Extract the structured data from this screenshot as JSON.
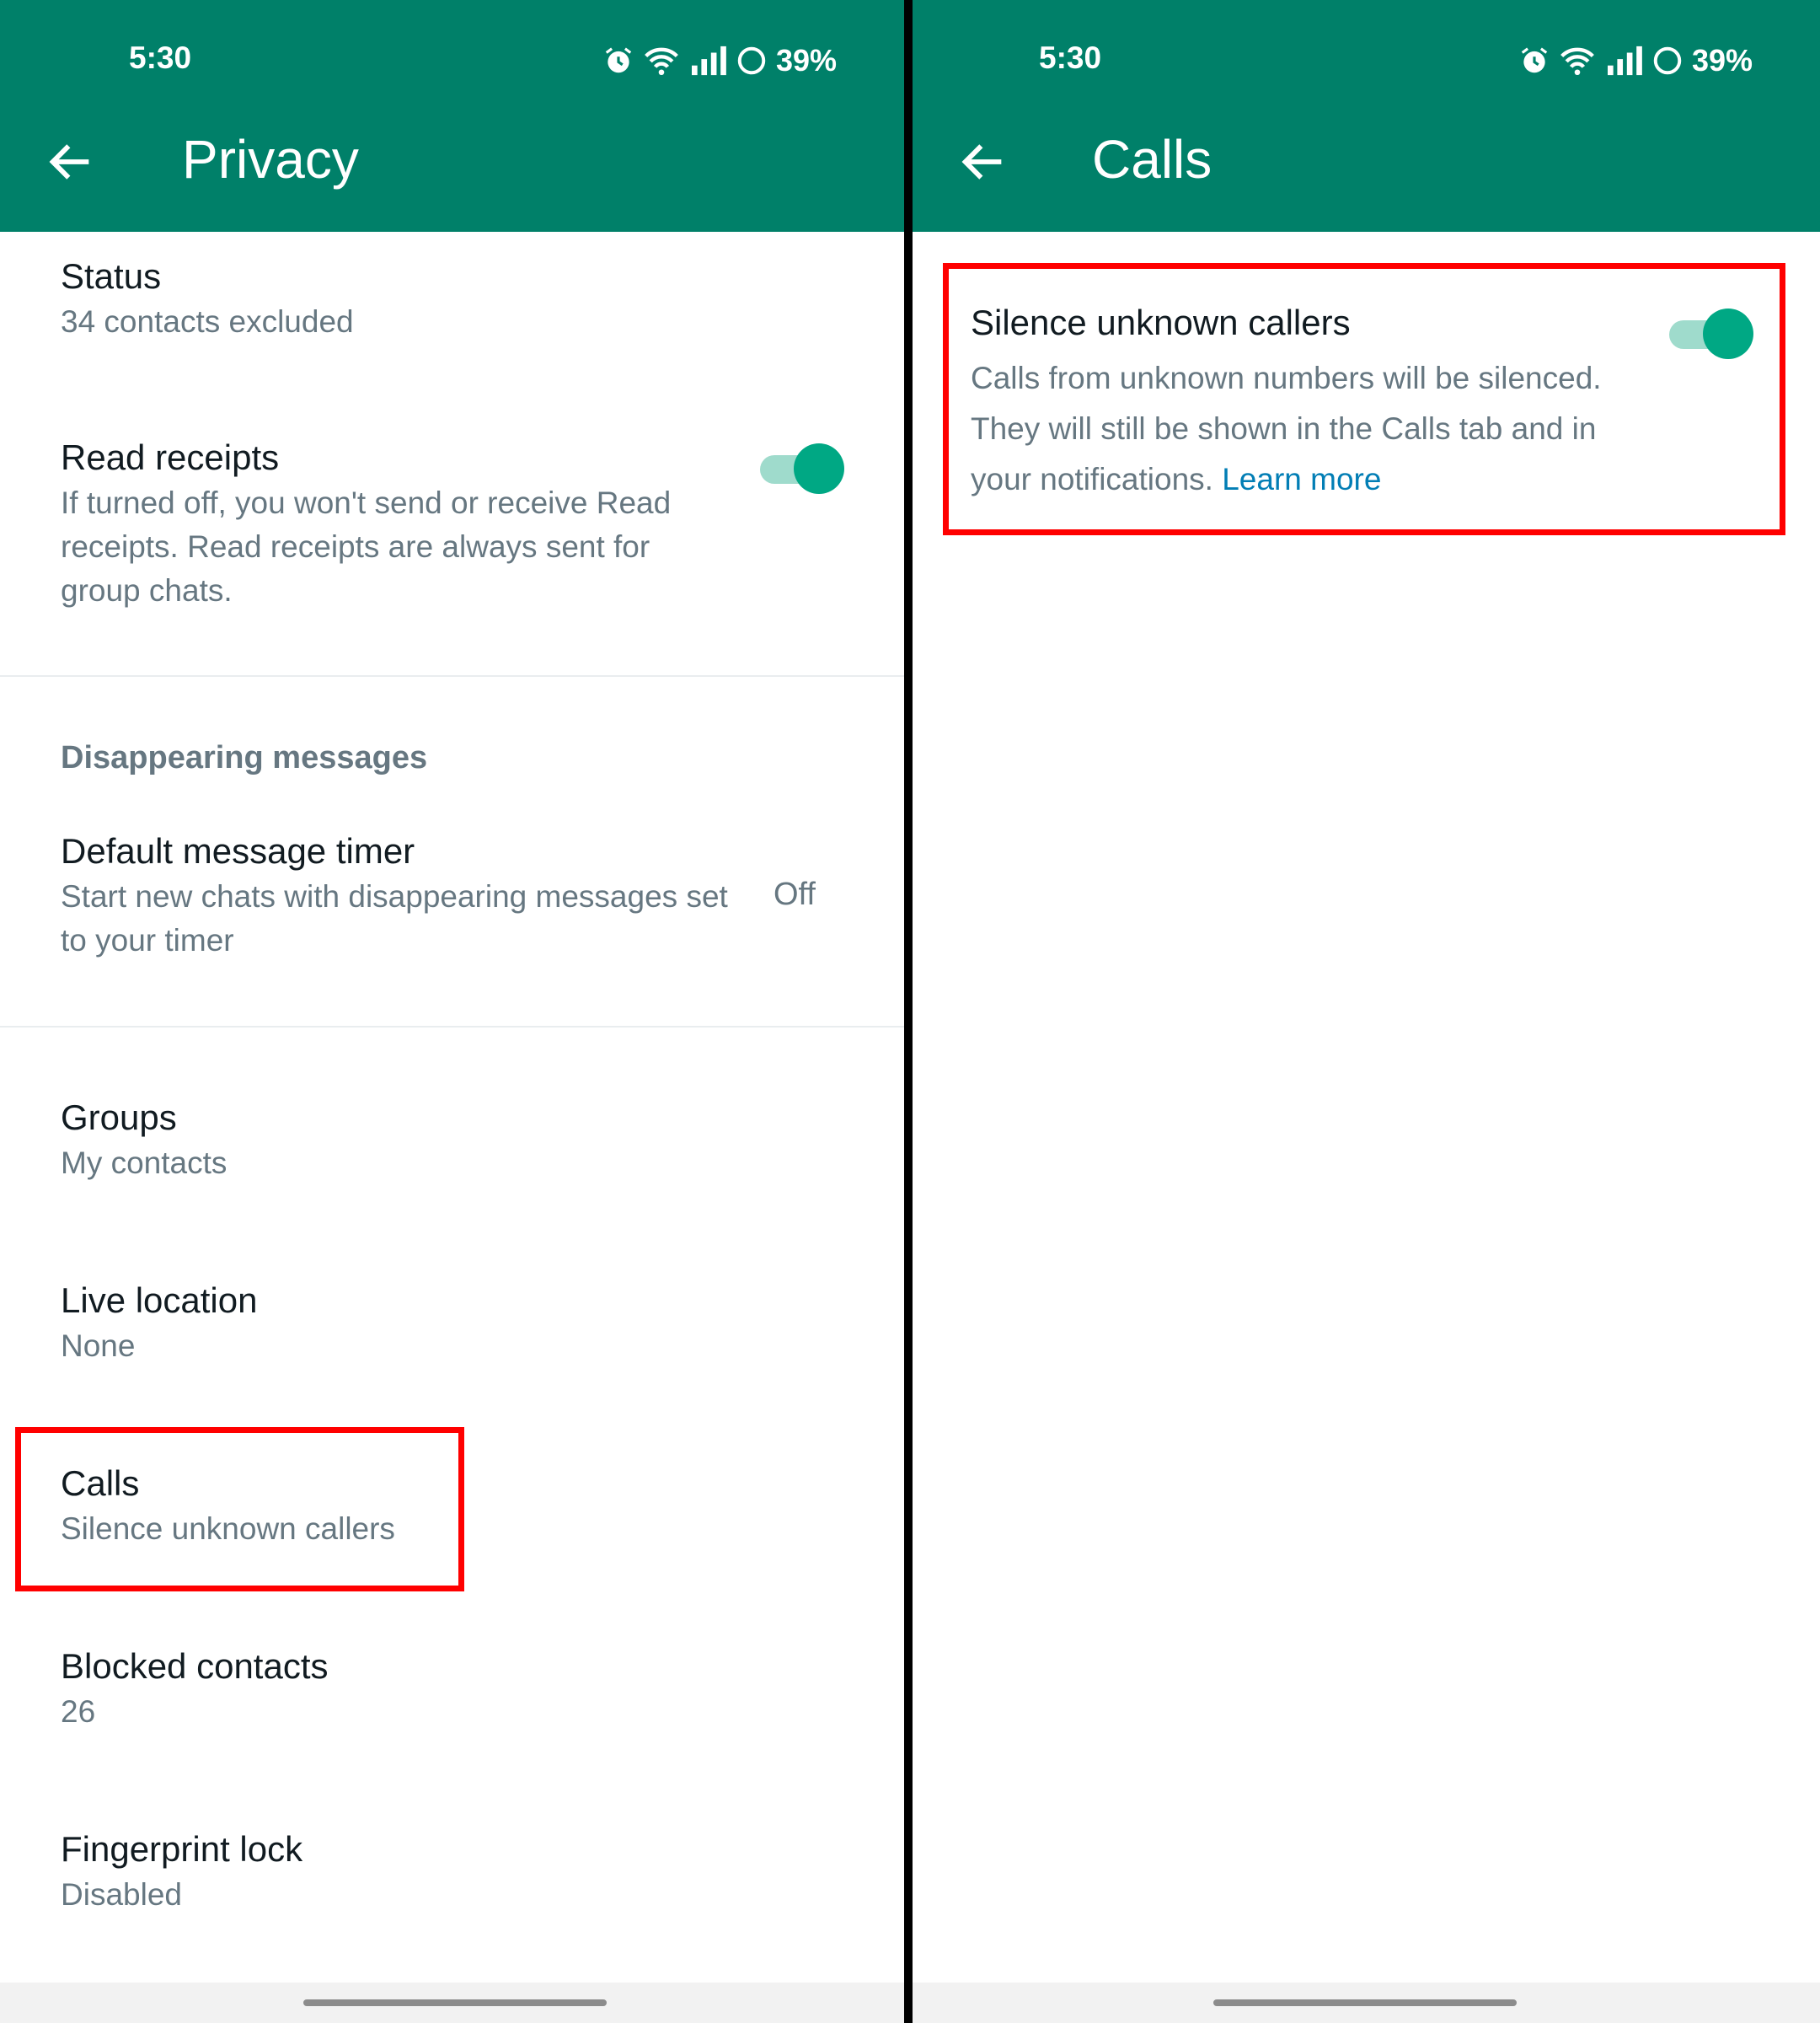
{
  "colors": {
    "appbar": "#008069",
    "accent": "#00a884",
    "highlight": "#ff0000",
    "link": "#027eb5"
  },
  "left": {
    "status_bar": {
      "time": "5:30",
      "battery": "39%",
      "icons": [
        "alarm-icon",
        "wifi-icon",
        "signal-icon",
        "battery-icon"
      ]
    },
    "header": {
      "title": "Privacy",
      "back_icon": "arrow-left-icon"
    },
    "items": {
      "status": {
        "title": "Status",
        "subtitle": "34 contacts excluded"
      },
      "read_receipts": {
        "title": "Read receipts",
        "subtitle": "If turned off, you won't send or receive Read receipts. Read receipts are always sent for group chats.",
        "toggle_on": true
      },
      "disappearing_header": "Disappearing messages",
      "default_timer": {
        "title": "Default message timer",
        "subtitle": "Start new chats with disappearing messages set to your timer",
        "value": "Off"
      },
      "groups": {
        "title": "Groups",
        "subtitle": "My contacts"
      },
      "live_location": {
        "title": "Live location",
        "subtitle": "None"
      },
      "calls": {
        "title": "Calls",
        "subtitle": "Silence unknown callers"
      },
      "blocked": {
        "title": "Blocked contacts",
        "subtitle": "26"
      },
      "fingerprint": {
        "title": "Fingerprint lock",
        "subtitle": "Disabled"
      }
    }
  },
  "right": {
    "status_bar": {
      "time": "5:30",
      "battery": "39%"
    },
    "header": {
      "title": "Calls",
      "back_icon": "arrow-left-icon"
    },
    "silence": {
      "title": "Silence unknown callers",
      "description": "Calls from unknown numbers will be silenced. They will still be shown in the Calls tab and in your notifications.",
      "link": "Learn more",
      "toggle_on": true
    }
  }
}
